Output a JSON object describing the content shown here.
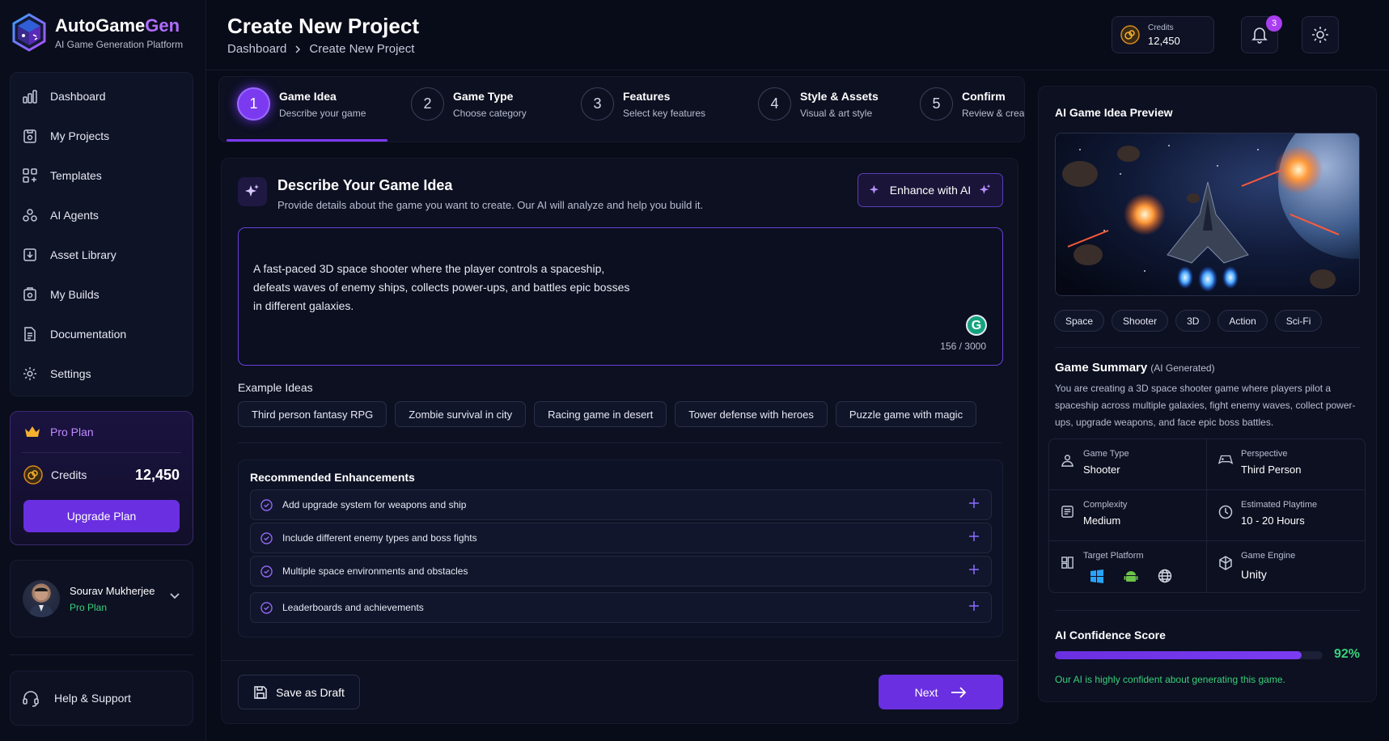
{
  "app": {
    "name_part1": "AutoGame",
    "name_part2": "Gen",
    "tagline": "AI Game Generation Platform"
  },
  "nav": {
    "items": [
      {
        "label": "Dashboard",
        "icon": "dashboard-icon"
      },
      {
        "label": "My Projects",
        "icon": "projects-icon"
      },
      {
        "label": "Templates",
        "icon": "templates-icon"
      },
      {
        "label": "AI Agents",
        "icon": "agents-icon"
      },
      {
        "label": "Asset Library",
        "icon": "asset-icon"
      },
      {
        "label": "My Builds",
        "icon": "builds-icon"
      },
      {
        "label": "Documentation",
        "icon": "documentation-icon"
      },
      {
        "label": "Settings",
        "icon": "gear-icon"
      }
    ]
  },
  "plan": {
    "name": "Pro Plan",
    "credits_label": "Credits",
    "credits_value": "12,450",
    "upgrade_label": "Upgrade Plan"
  },
  "user": {
    "name": "Sourav Mukherjee",
    "plan": "Pro Plan"
  },
  "help": {
    "label": "Help & Support"
  },
  "header": {
    "title": "Create New Project",
    "breadcrumb": [
      "Dashboard",
      "Create New Project"
    ],
    "credits_label": "Credits",
    "credits_value": "12,450",
    "notifications_count": "3"
  },
  "steps": [
    {
      "num": "1",
      "title": "Game Idea",
      "sub": "Describe your game"
    },
    {
      "num": "2",
      "title": "Game Type",
      "sub": "Choose category"
    },
    {
      "num": "3",
      "title": "Features",
      "sub": "Select key features"
    },
    {
      "num": "4",
      "title": "Style & Assets",
      "sub": "Visual & art style"
    },
    {
      "num": "5",
      "title": "Confirm",
      "sub": "Review & create"
    }
  ],
  "idea": {
    "title": "Describe Your Game Idea",
    "subtitle": "Provide details about the game you want to create. Our AI will analyze and help you build it.",
    "enhance_label": "Enhance with AI",
    "text": "A fast-paced 3D space shooter where the player controls a spaceship,\ndefeats waves of enemy ships, collects power-ups, and battles epic bosses\nin different galaxies.",
    "counter": "156 / 3000",
    "examples_label": "Example Ideas",
    "examples": [
      "Third person fantasy RPG",
      "Zombie survival in city",
      "Racing game in desert",
      "Tower defense with heroes",
      "Puzzle game with magic"
    ]
  },
  "enhancements": {
    "title": "Recommended Enhancements",
    "items": [
      "Add upgrade system for weapons and ship",
      "Include different enemy types and boss fights",
      "Multiple space environments and obstacles",
      "Leaderboards and achievements"
    ]
  },
  "actions": {
    "draft": "Save as Draft",
    "next": "Next"
  },
  "preview": {
    "title": "AI Game Idea Preview",
    "tags": [
      "Space",
      "Shooter",
      "3D",
      "Action",
      "Sci-Fi"
    ],
    "summary_title": "Game Summary",
    "summary_note": "(AI Generated)",
    "summary_text": "You are creating a 3D space shooter game where players pilot a spaceship across multiple galaxies, fight enemy waves, collect power-ups, upgrade weapons, and face epic boss battles.",
    "details": {
      "game_type": {
        "label": "Game Type",
        "value": "Shooter"
      },
      "perspective": {
        "label": "Perspective",
        "value": "Third Person"
      },
      "complexity": {
        "label": "Complexity",
        "value": "Medium"
      },
      "playtime": {
        "label": "Estimated Playtime",
        "value": "10 - 20 Hours"
      },
      "platform": {
        "label": "Target Platform",
        "icons": [
          "windows-icon",
          "android-icon",
          "web-globe-icon"
        ]
      },
      "engine": {
        "label": "Game Engine",
        "value": "Unity"
      }
    },
    "confidence": {
      "title": "AI Confidence Score",
      "value": "92%",
      "fraction": 0.92,
      "note": "Our AI is highly confident about generating this game."
    }
  },
  "colors": {
    "accent": "#6a2fe0",
    "accent_light": "#b06cff",
    "success": "#3ad07a",
    "background": "#080b18"
  }
}
